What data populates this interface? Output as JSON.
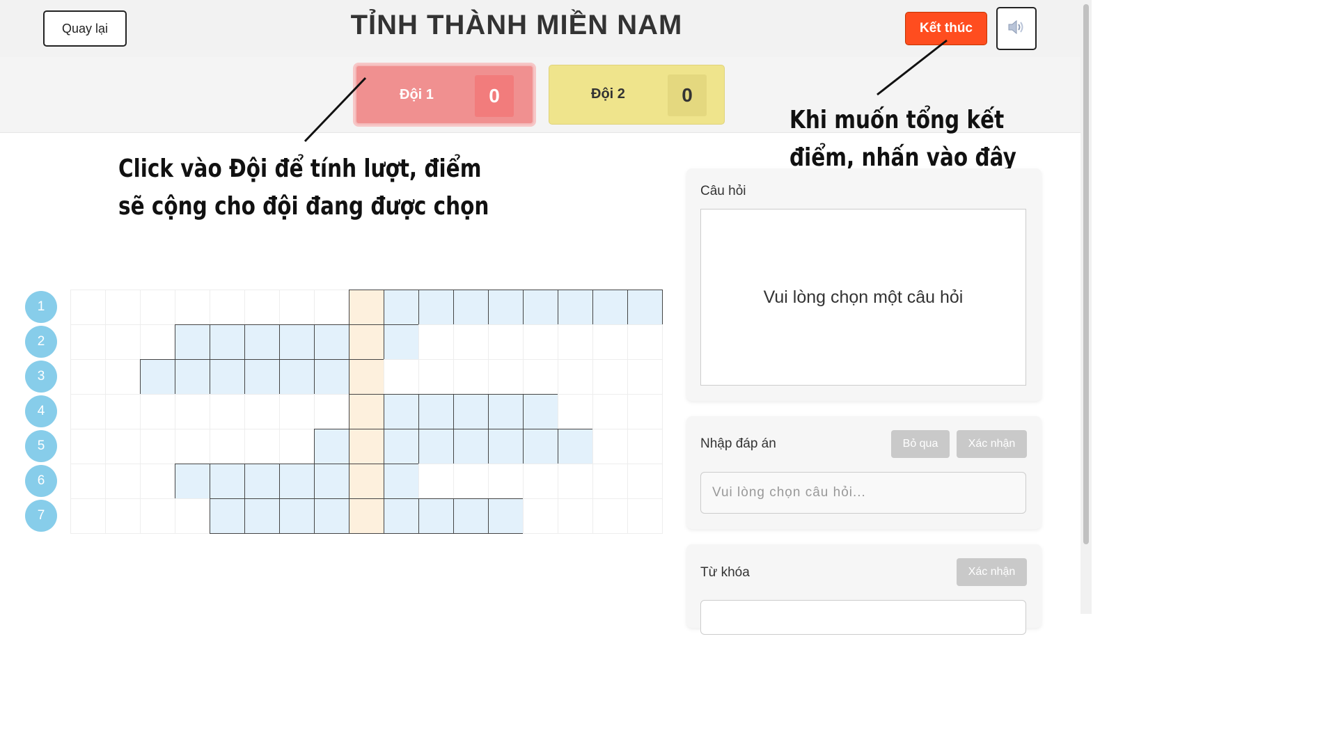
{
  "header": {
    "back_label": "Quay lại",
    "title": "TỈNH THÀNH MIỀN NAM",
    "end_label": "Kết thúc",
    "sound_icon": "speaker-icon"
  },
  "teams": [
    {
      "name": "Đội 1",
      "score": "0",
      "color": "#f09090",
      "selected": true
    },
    {
      "name": "Đội 2",
      "score": "0",
      "color": "#efe48c",
      "selected": false
    }
  ],
  "annotations": {
    "teams_line1": "Click vào Đội để tính lượt, điểm",
    "teams_line2": "sẽ cộng cho đội đang được chọn",
    "end_line1": "Khi muốn tổng kết",
    "end_line2": "điểm, nhấn vào đây"
  },
  "crossword": {
    "columns": 17,
    "key_column": 8,
    "rows": [
      {
        "number": "1",
        "start": 8,
        "length": 9
      },
      {
        "number": "2",
        "start": 3,
        "length": 7
      },
      {
        "number": "3",
        "start": 2,
        "length": 7
      },
      {
        "number": "4",
        "start": 8,
        "length": 6
      },
      {
        "number": "5",
        "start": 7,
        "length": 8
      },
      {
        "number": "6",
        "start": 3,
        "length": 7
      },
      {
        "number": "7",
        "start": 4,
        "length": 9
      }
    ],
    "cell_color": "#e3f1fb",
    "key_color": "#fdf0dd"
  },
  "question_panel": {
    "label": "Câu hỏi",
    "placeholder_text": "Vui lòng chọn một câu hỏi"
  },
  "answer_panel": {
    "label": "Nhập đáp án",
    "skip_label": "Bỏ qua",
    "confirm_label": "Xác nhận",
    "input_placeholder": "Vui lòng chọn câu hỏi..."
  },
  "keyword_panel": {
    "label": "Từ khóa",
    "confirm_label": "Xác nhận"
  }
}
